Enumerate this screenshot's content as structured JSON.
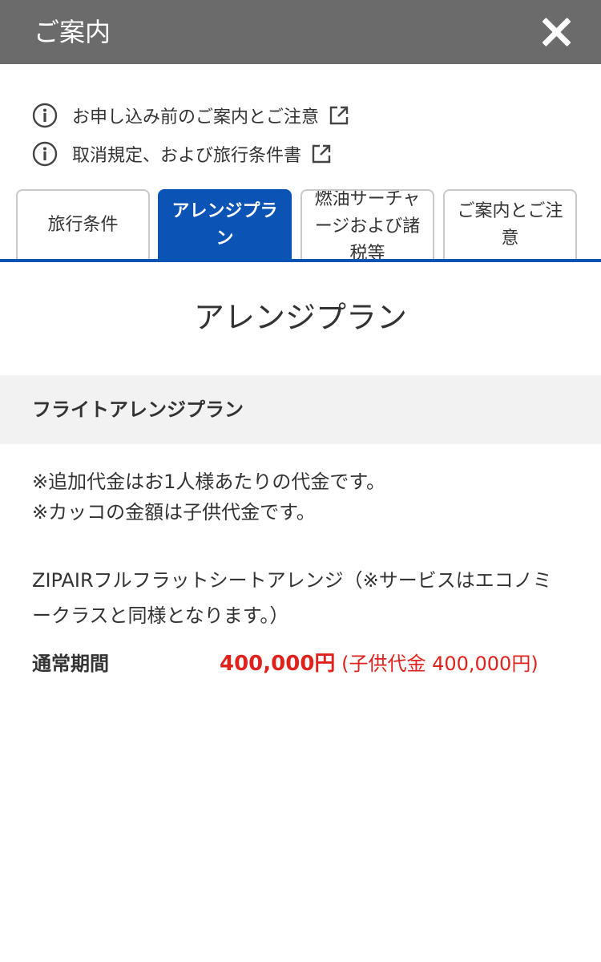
{
  "header": {
    "title": "ご案内",
    "close_icon": "close-icon"
  },
  "info_links": [
    {
      "label": "お申し込み前のご案内とご注意",
      "icon": "info-icon",
      "trailing_icon": "external-link-icon"
    },
    {
      "label": "取消規定、および旅行条件書",
      "icon": "info-icon",
      "trailing_icon": "external-link-icon"
    }
  ],
  "tabs": [
    {
      "label": "旅行条件",
      "active": false
    },
    {
      "label": "アレンジプラン",
      "active": true
    },
    {
      "label": "燃油サーチャージおよび諸税等",
      "active": false
    },
    {
      "label": "ご案内とご注意",
      "active": false
    }
  ],
  "content": {
    "section_title": "アレンジプラン",
    "subhead": "フライトアレンジプラン",
    "notes": [
      "※追加代金はお1人様あたりの代金です。",
      "※カッコの金額は子供代金です。"
    ],
    "plan_description": "ZIPAIRフルフラットシートアレンジ（※サービスはエコノミークラスと同様となります。）",
    "period_label": "通常期間",
    "price": "400,000円",
    "child_price": "(子供代金 400,000円)"
  },
  "colors": {
    "header_bg": "#6b6b6b",
    "accent_blue": "#0b53b5",
    "price_red": "#e0221c",
    "subhead_bg": "#f2f2f2"
  }
}
